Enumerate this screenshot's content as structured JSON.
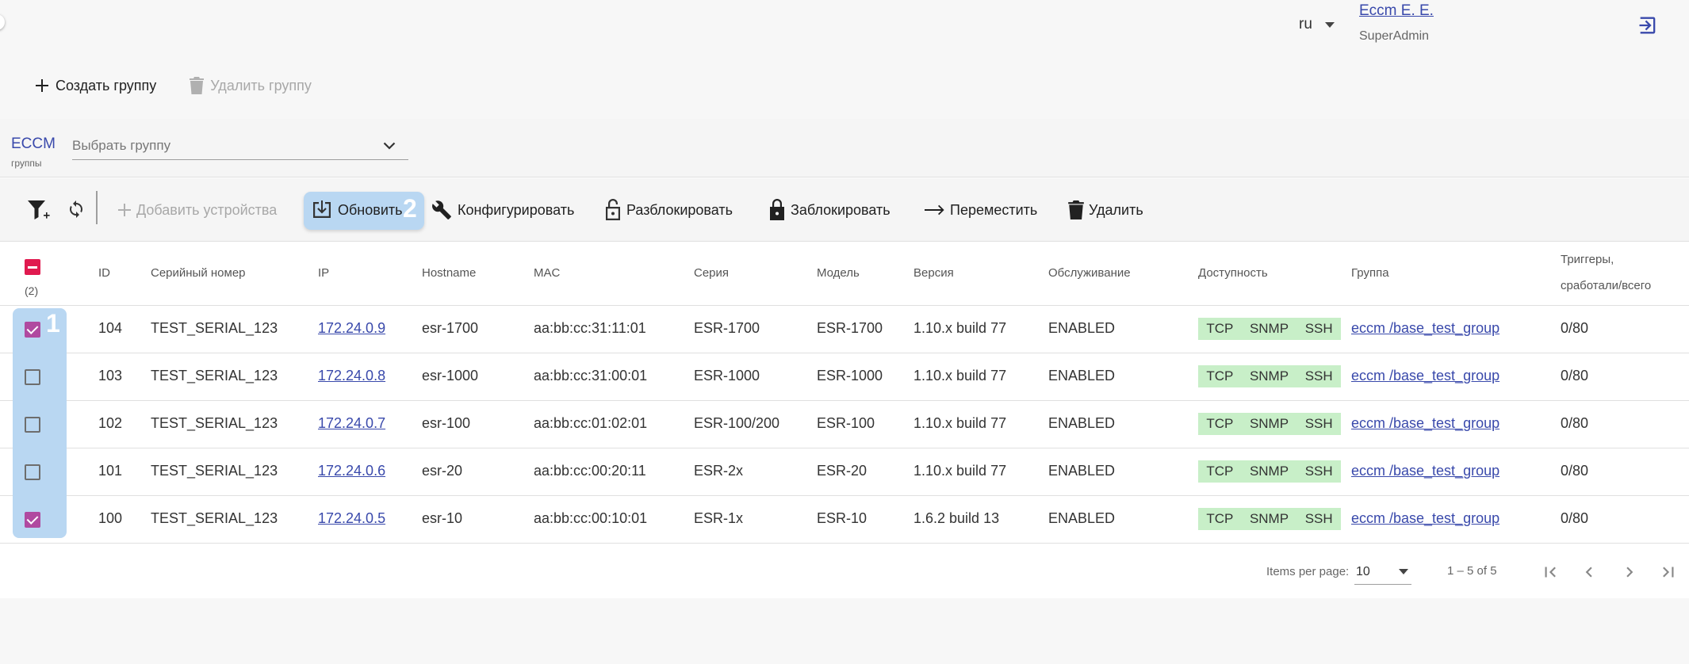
{
  "header": {
    "lang": "ru",
    "user_name": "Eccm E. E.",
    "user_role": "SuperAdmin"
  },
  "group_actions": {
    "create_label": "Создать группу",
    "delete_label": "Удалить группу"
  },
  "group_bar": {
    "title": "ECCM",
    "subtitle": "группы",
    "select_placeholder": "Выбрать группу"
  },
  "toolbar": {
    "add_devices": "Добавить устройства",
    "refresh": "Обновить",
    "configure": "Конфигурировать",
    "unlock": "Разблокировать",
    "lock": "Заблокировать",
    "move": "Переместить",
    "delete": "Удалить"
  },
  "callouts": {
    "one": "1",
    "two": "2"
  },
  "table": {
    "selected_count": "(2)",
    "headers": {
      "id": "ID",
      "serial": "Серийный номер",
      "ip": "IP",
      "hostname": "Hostname",
      "mac": "MAC",
      "series": "Серия",
      "model": "Модель",
      "version": "Версия",
      "service": "Обслуживание",
      "availability": "Доступность",
      "group": "Группа",
      "triggers_line1": "Триггеры,",
      "triggers_line2": "сработали/всего"
    },
    "rows": [
      {
        "id": "104",
        "serial": "TEST_SERIAL_123",
        "ip": "172.24.0.9",
        "hostname": "esr-1700",
        "mac": "aa:bb:cc:31:11:01",
        "series": "ESR-1700",
        "model": "ESR-1700",
        "version": "1.10.x build 77",
        "service": "ENABLED",
        "avail": [
          "TCP",
          "SNMP",
          "SSH"
        ],
        "group": "eccm /base_test_group",
        "triggers": "0/80",
        "checked": true
      },
      {
        "id": "103",
        "serial": "TEST_SERIAL_123",
        "ip": "172.24.0.8",
        "hostname": "esr-1000",
        "mac": "aa:bb:cc:31:00:01",
        "series": "ESR-1000",
        "model": "ESR-1000",
        "version": "1.10.x build 77",
        "service": "ENABLED",
        "avail": [
          "TCP",
          "SNMP",
          "SSH"
        ],
        "group": "eccm /base_test_group",
        "triggers": "0/80",
        "checked": false
      },
      {
        "id": "102",
        "serial": "TEST_SERIAL_123",
        "ip": "172.24.0.7",
        "hostname": "esr-100",
        "mac": "aa:bb:cc:01:02:01",
        "series": "ESR-100/200",
        "model": "ESR-100",
        "version": "1.10.x build 77",
        "service": "ENABLED",
        "avail": [
          "TCP",
          "SNMP",
          "SSH"
        ],
        "group": "eccm /base_test_group",
        "triggers": "0/80",
        "checked": false
      },
      {
        "id": "101",
        "serial": "TEST_SERIAL_123",
        "ip": "172.24.0.6",
        "hostname": "esr-20",
        "mac": "aa:bb:cc:00:20:11",
        "series": "ESR-2x",
        "model": "ESR-20",
        "version": "1.10.x build 77",
        "service": "ENABLED",
        "avail": [
          "TCP",
          "SNMP",
          "SSH"
        ],
        "group": "eccm /base_test_group",
        "triggers": "0/80",
        "checked": false
      },
      {
        "id": "100",
        "serial": "TEST_SERIAL_123",
        "ip": "172.24.0.5",
        "hostname": "esr-10",
        "mac": "aa:bb:cc:00:10:01",
        "series": "ESR-1x",
        "model": "ESR-10",
        "version": "1.6.2 build 13",
        "service": "ENABLED",
        "avail": [
          "TCP",
          "SNMP",
          "SSH"
        ],
        "group": "eccm /base_test_group",
        "triggers": "0/80",
        "checked": true
      }
    ]
  },
  "paginator": {
    "label": "Items per page:",
    "page_size": "10",
    "range": "1 – 5 of 5"
  },
  "colors": {
    "accent": "#3949ab",
    "checkbox_checked": "#b04aa0",
    "checkbox_indeterminate": "#e01a4f",
    "highlight": "#b9d7f2",
    "availability_chip": "#c8efc8"
  },
  "icons": [
    "plus-icon",
    "trash-icon",
    "chevron-down-icon",
    "filter-add-icon",
    "sync-icon",
    "download-icon",
    "wrench-icon",
    "unlock-icon",
    "lock-icon",
    "arrow-right-icon",
    "logout-icon",
    "first-page-icon",
    "prev-page-icon",
    "next-page-icon",
    "last-page-icon"
  ]
}
